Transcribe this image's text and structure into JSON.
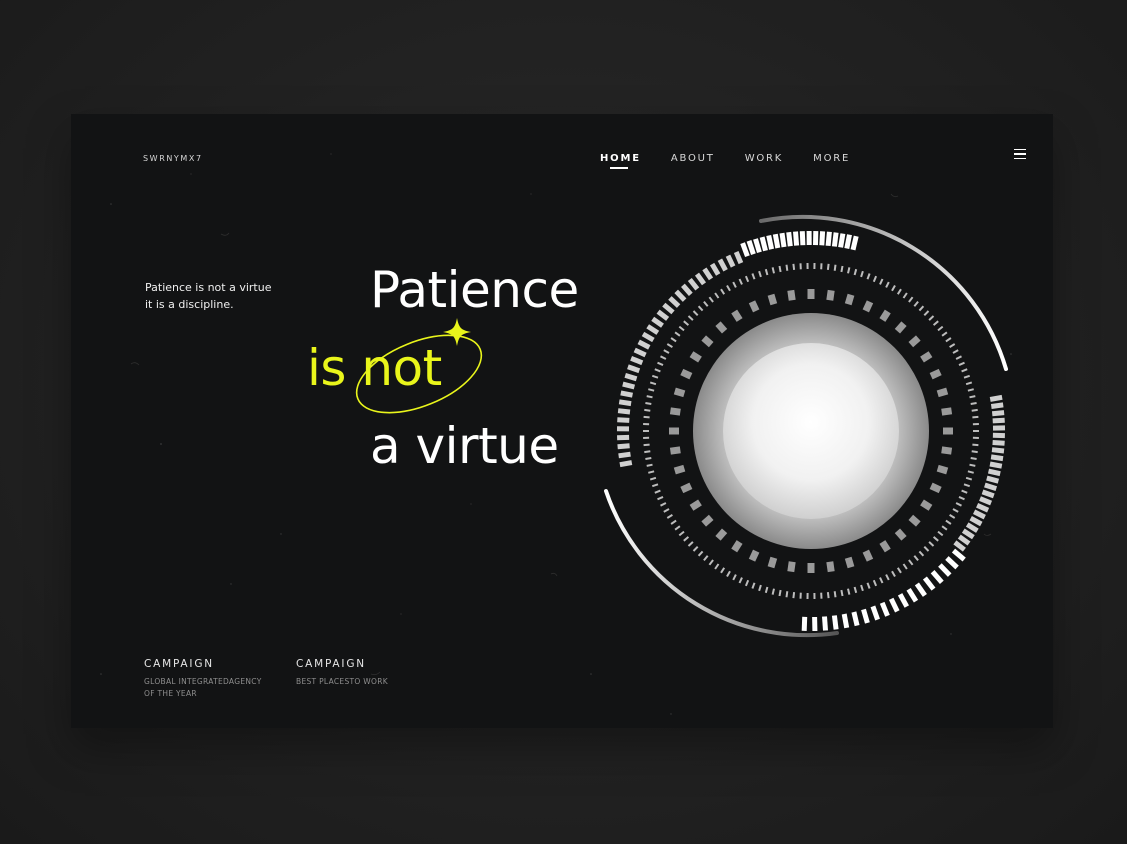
{
  "brand": "SWRNYMX7",
  "nav": {
    "items": [
      {
        "label": "HOME",
        "active": true
      },
      {
        "label": "ABOUT",
        "active": false
      },
      {
        "label": "WORK",
        "active": false
      },
      {
        "label": "MORE",
        "active": false
      }
    ]
  },
  "menu_icon": "hamburger-menu-icon",
  "tagline": {
    "line1": "Patience is not a virtue",
    "line2": "it is a discipline."
  },
  "hero": {
    "line1": "Patience",
    "line2": "is not",
    "line3": "a virtue"
  },
  "footer": [
    {
      "title": "CAMPAIGN",
      "subtitle_lines": [
        "GLOBAL INTEGRATEDAGENCY",
        "OF THE YEAR"
      ]
    },
    {
      "title": "CAMPAIGN",
      "subtitle_lines": [
        "BEST PLACESTO WORK"
      ]
    }
  ],
  "colors": {
    "background": "#121314",
    "accent": "#e9f51b",
    "text": "#ffffff"
  },
  "decor_icons": [
    "sparkle-star-icon",
    "orbit-ellipse",
    "concentric-rings-graphic"
  ]
}
